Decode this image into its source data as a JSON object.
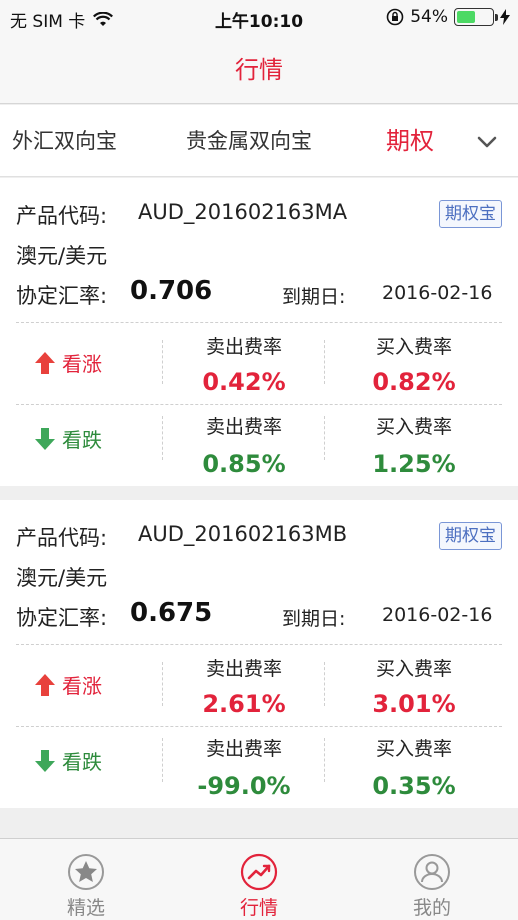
{
  "status_bar": {
    "carrier": "无 SIM 卡",
    "time": "上午10:10",
    "battery": "54%",
    "battery_level": 0.54,
    "colors": {
      "battery_fill": "#4cd964"
    }
  },
  "nav": {
    "title": "行情"
  },
  "category_tabs": {
    "items": [
      "外汇双向宝",
      "贵金属双向宝",
      "期权"
    ],
    "active_index": 2
  },
  "products": [
    {
      "code_label": "产品代码:",
      "code": "AUD_201602163MA",
      "badge": "期权宝",
      "pair": "澳元/美元",
      "strike_label": "协定汇率:",
      "strike": "0.706",
      "expiry_label": "到期日:",
      "expiry": "2016-02-16",
      "up": {
        "label": "看涨",
        "sell_label": "卖出费率",
        "sell": "0.42%",
        "buy_label": "买入费率",
        "buy": "0.82%"
      },
      "down": {
        "label": "看跌",
        "sell_label": "卖出费率",
        "sell": "0.85%",
        "buy_label": "买入费率",
        "buy": "1.25%"
      }
    },
    {
      "code_label": "产品代码:",
      "code": "AUD_201602163MB",
      "badge": "期权宝",
      "pair": "澳元/美元",
      "strike_label": "协定汇率:",
      "strike": "0.675",
      "expiry_label": "到期日:",
      "expiry": "2016-02-16",
      "up": {
        "label": "看涨",
        "sell_label": "卖出费率",
        "sell": "2.61%",
        "buy_label": "买入费率",
        "buy": "3.01%"
      },
      "down": {
        "label": "看跌",
        "sell_label": "卖出费率",
        "sell": "-99.0%",
        "buy_label": "买入费率",
        "buy": "0.35%"
      }
    }
  ],
  "tab_bar": {
    "items": [
      {
        "label": "精选",
        "icon": "star-icon"
      },
      {
        "label": "行情",
        "icon": "trend-chart-icon"
      },
      {
        "label": "我的",
        "icon": "user-icon"
      }
    ],
    "active_index": 1
  },
  "colors": {
    "accent": "#e2233b",
    "up": "#e2233b",
    "down": "#2e8b3c",
    "badge": "#4c6fc0"
  }
}
